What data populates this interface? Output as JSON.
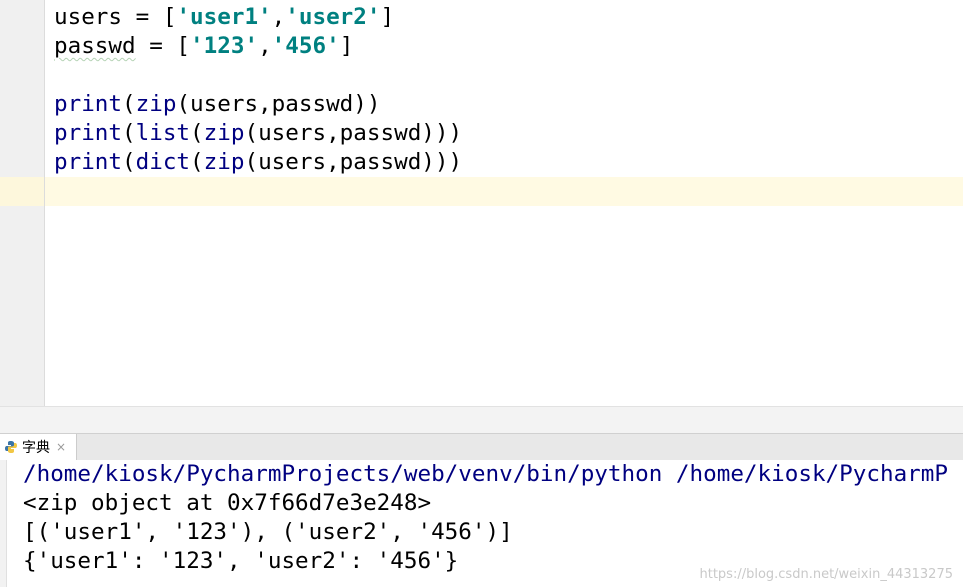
{
  "editor": {
    "lines": [
      {
        "parts": [
          {
            "t": "users = [",
            "c": "plain"
          },
          {
            "t": "'user1'",
            "c": "str"
          },
          {
            "t": ",",
            "c": "plain"
          },
          {
            "t": "'user2'",
            "c": "str"
          },
          {
            "t": "]",
            "c": "plain"
          }
        ]
      },
      {
        "parts": [
          {
            "t": "passwd",
            "c": "squiggle"
          },
          {
            "t": " = [",
            "c": "plain"
          },
          {
            "t": "'123'",
            "c": "str"
          },
          {
            "t": ",",
            "c": "plain"
          },
          {
            "t": "'456'",
            "c": "str"
          },
          {
            "t": "]",
            "c": "plain"
          }
        ]
      },
      {
        "parts": []
      },
      {
        "parts": [
          {
            "t": "print",
            "c": "kw"
          },
          {
            "t": "(",
            "c": "plain"
          },
          {
            "t": "zip",
            "c": "kw"
          },
          {
            "t": "(users,passwd))",
            "c": "plain"
          }
        ]
      },
      {
        "parts": [
          {
            "t": "print",
            "c": "kw"
          },
          {
            "t": "(",
            "c": "plain"
          },
          {
            "t": "list",
            "c": "kw"
          },
          {
            "t": "(",
            "c": "plain"
          },
          {
            "t": "zip",
            "c": "kw"
          },
          {
            "t": "(users,passwd)))",
            "c": "plain"
          }
        ]
      },
      {
        "parts": [
          {
            "t": "print",
            "c": "kw"
          },
          {
            "t": "(",
            "c": "plain"
          },
          {
            "t": "dict",
            "c": "kw"
          },
          {
            "t": "(",
            "c": "plain"
          },
          {
            "t": "zip",
            "c": "kw"
          },
          {
            "t": "(users,passwd)))",
            "c": "plain"
          }
        ]
      }
    ]
  },
  "run_tab": {
    "label": "字典",
    "close": "×",
    "icon": "python-icon"
  },
  "console": {
    "path_line": "/home/kiosk/PycharmProjects/web/venv/bin/python /home/kiosk/PycharmP",
    "output": [
      "<zip object at 0x7f66d7e3e248>",
      "[('user1', '123'), ('user2', '456')]",
      "{'user1': '123', 'user2': '456'}"
    ]
  },
  "watermark": "https://blog.csdn.net/weixin_44313275",
  "colors": {
    "keyword": "#000080",
    "string": "#008080",
    "caret_row": "#fffae3"
  }
}
